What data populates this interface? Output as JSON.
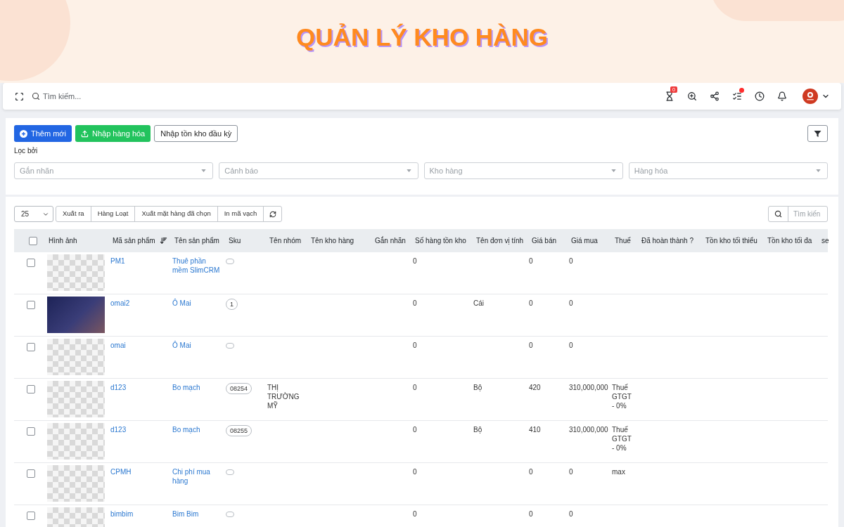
{
  "title": "QUẢN LÝ KHO HÀNG",
  "topbar": {
    "search": {
      "placeholder": "Tìm kiếm..."
    },
    "timer_badge": "0",
    "tasks_unread": true
  },
  "actions": [
    {
      "label": "Thêm mới",
      "kind": "primary"
    },
    {
      "label": "Nhập hàng hóa",
      "kind": "success"
    },
    {
      "label": "Nhập tồn kho đầu kỳ",
      "kind": "outline"
    }
  ],
  "filter_label": "Lọc bởi",
  "filters": [
    {
      "placeholder": "Gắn nhãn"
    },
    {
      "placeholder": "Cảnh báo"
    },
    {
      "placeholder": "Kho hàng"
    },
    {
      "placeholder": "Hàng hóa"
    }
  ],
  "toolbar": {
    "page_size": "25",
    "buttons": [
      "Xuất ra",
      "Hàng Loạt",
      "Xuất mặt hàng đã chọn",
      "In mã vạch"
    ],
    "search": {
      "placeholder": "Tìm kiến"
    }
  },
  "table": {
    "select_all": {
      "checked": false
    },
    "columns": [
      {
        "label": "Hình ảnh",
        "sorted": false
      },
      {
        "label": "Mã sản phẩm",
        "sorted": true
      },
      {
        "label": "Tên sản phẩm",
        "sorted": false
      },
      {
        "label": "Sku",
        "sorted": false
      },
      {
        "label": "Tên nhóm",
        "sorted": false
      },
      {
        "label": "Tên kho hàng",
        "sorted": false
      },
      {
        "label": "Gắn nhãn",
        "sorted": false
      },
      {
        "label": "Số hàng tồn kho",
        "sorted": false
      },
      {
        "label": "Tên đơn vị tính",
        "sorted": false
      },
      {
        "label": "Giá bán",
        "sorted": false
      },
      {
        "label": "Giá mua",
        "sorted": false
      },
      {
        "label": "Thuế",
        "sorted": false
      },
      {
        "label": "Đã hoàn thành ?",
        "sorted": false
      },
      {
        "label": "Tồn kho tối thiểu",
        "sorted": false
      },
      {
        "label": "Tồn kho tối đa",
        "sorted": false
      },
      {
        "label": "se",
        "sorted": false
      }
    ],
    "rows": [
      {
        "checked": false,
        "kind": "checker",
        "code": "PM1",
        "name": "Thuê phần mềm SlimCRM",
        "stock": "0",
        "sale_price": "0",
        "cost_price": "0"
      },
      {
        "checked": false,
        "kind": "photo",
        "code": "omai2",
        "name": "Ô Mai",
        "sku": "1",
        "stock": "0",
        "unit": "Cái",
        "sale_price": "0",
        "cost_price": "0"
      },
      {
        "checked": false,
        "kind": "checker",
        "code": "omai",
        "name": "Ô Mai",
        "stock": "0",
        "sale_price": "0",
        "cost_price": "0"
      },
      {
        "checked": false,
        "kind": "checker",
        "code": "d123",
        "name": "Bo mạch",
        "sku": "08254",
        "group": "THỊ TRƯỜNG MỸ",
        "stock": "0",
        "unit": "Bộ",
        "sale_price": "420",
        "cost_price": "310,000,000",
        "tax": "Thuế GTGT - 0%"
      },
      {
        "checked": false,
        "kind": "checker",
        "code": "d123",
        "name": "Bo mạch",
        "sku": "08255",
        "stock": "0",
        "unit": "Bộ",
        "sale_price": "410",
        "cost_price": "310,000,000",
        "tax": "Thuế GTGT - 0%"
      },
      {
        "checked": false,
        "kind": "checker",
        "code": "CPMH",
        "name": "Chi phí mua hàng",
        "stock": "0",
        "sale_price": "0",
        "cost_price": "0",
        "tax": "max"
      },
      {
        "checked": false,
        "kind": "checker",
        "code": "bimbim",
        "name": "Bim Bim",
        "stock": "0",
        "sale_price": "0",
        "cost_price": "0"
      }
    ]
  }
}
